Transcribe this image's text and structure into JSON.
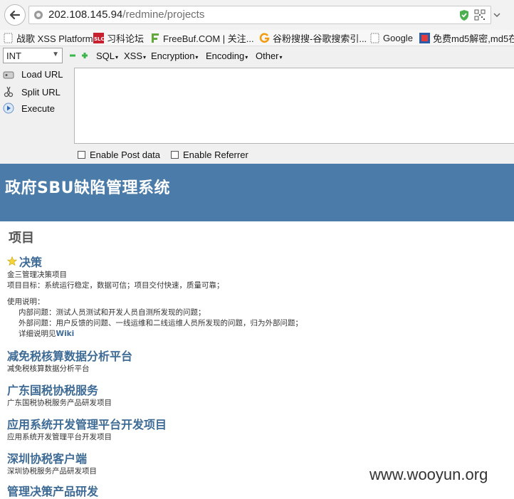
{
  "browser": {
    "url_host": "202.108.145.94",
    "url_path": "/redmine/projects"
  },
  "bookmarks": [
    {
      "label": "战歌 XSS Platform",
      "icon": "page-icon"
    },
    {
      "label": "习科论坛",
      "icon": "slc-logo-icon"
    },
    {
      "label": "FreeBuf.COM | 关注...",
      "icon": "freebuf-f-icon"
    },
    {
      "label": "谷粉搜搜-谷歌搜索引...",
      "icon": "g-logo-icon"
    },
    {
      "label": "Google",
      "icon": "page-icon"
    },
    {
      "label": "免费md5解密,md5在",
      "icon": "md5-icon"
    }
  ],
  "hackbar": {
    "select_value": "INT",
    "menus": [
      "SQL",
      "XSS",
      "Encryption",
      "Encoding",
      "Other"
    ],
    "buttons": {
      "load": "Load URL",
      "split": "Split URL",
      "execute": "Execute"
    },
    "checkboxes": {
      "post": "Enable Post data",
      "referrer": "Enable Referrer"
    }
  },
  "header": {
    "title": "政府SBU缺陷管理系统"
  },
  "page": {
    "title": "项目",
    "projects": [
      {
        "name": "决策",
        "desc": "金三管理决策项目",
        "desc2": "项目目标：系统运行稳定，数据可信；项目交付快速，质量可靠；"
      },
      {
        "name": "减免税核算数据分析平台",
        "desc": "减免税核算数据分析平台"
      },
      {
        "name": "广东国税协税服务",
        "desc": "广东国税协税服务产品研发项目"
      },
      {
        "name": "应用系统开发管理平台开发项目",
        "desc": "应用系统开发管理平台开发项目"
      },
      {
        "name": "深圳协税客户端",
        "desc": "深圳协税服务产品研发项目"
      },
      {
        "name": "管理决策产品研发",
        "desc": ""
      }
    ],
    "usage": {
      "heading": "使用说明：",
      "internal": "内部问题：测试人员测试和开发人员自测所发现的问题；",
      "external": "外部问题：用户反馈的问题、一线运维和二线运维人员所发现的问题，归为外部问题；",
      "detail_prefix": "详细说明见",
      "wiki_link": "Wiki"
    }
  },
  "watermark": "www.wooyun.org"
}
